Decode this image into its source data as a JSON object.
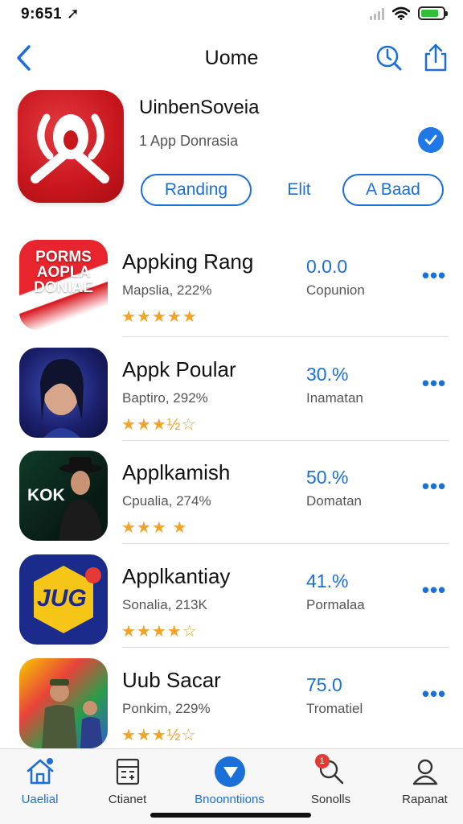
{
  "status_bar": {
    "time": "9:651 ➚",
    "battery_level": 0.8,
    "battery_color": "#2fbf3a"
  },
  "nav": {
    "title": "Uome",
    "icons": [
      "back-chevron-icon",
      "clock-search-icon",
      "share-icon"
    ]
  },
  "featured": {
    "title": "UinbenSoveia",
    "subtitle": "1 App Donrasia",
    "verified_icon": "checkmark-badge-icon",
    "buttons": [
      {
        "label": "Randing",
        "style": "outline"
      },
      {
        "label": "Elit",
        "style": "plain"
      },
      {
        "label": "A Baad",
        "style": "outline"
      }
    ]
  },
  "apps": [
    {
      "name": "Appking Rang",
      "meta": "Mapslia, 222%",
      "rating": 4.5,
      "value": "0.0.0",
      "label": "Copunion",
      "icon_text": "PORMS AOPLA DONIAE"
    },
    {
      "name": "Appk Poular",
      "meta": "Baptiro, 292%",
      "rating": 3.5,
      "value": "30.%",
      "label": "Inamatan",
      "icon_text": ""
    },
    {
      "name": "Applkamish",
      "meta": "Cpualia, 274%",
      "rating": 3.5,
      "value": "50.%",
      "label": "Domatan",
      "icon_text": "KOK"
    },
    {
      "name": "Applkantiay",
      "meta": "Sonalia, 213K",
      "rating": 4,
      "value": "41.%",
      "label": "Pormalaa",
      "icon_text": "JUG"
    },
    {
      "name": "Uub Sacar",
      "meta": "Ponkim, 229%",
      "rating": 3.5,
      "value": "75.0",
      "label": "Tromatiel",
      "icon_text": ""
    }
  ],
  "stars": {
    "row1": "★★★★★",
    "row2": "★★★½☆",
    "row3": "★★★ ★",
    "row4": "★★★★☆",
    "row5": "★★★½☆"
  },
  "tabs": [
    {
      "label": "Uaelial",
      "icon": "home-icon",
      "active": true
    },
    {
      "label": "Ctianet",
      "icon": "calculator-icon",
      "active": false
    },
    {
      "label": "Bnoonntiions",
      "icon": "play-circle-icon",
      "active": true
    },
    {
      "label": "Sonolls",
      "icon": "search-icon",
      "active": false,
      "badge": "1"
    },
    {
      "label": "Rapanat",
      "icon": "person-icon",
      "active": false
    }
  ],
  "colors": {
    "accent": "#1a6fd8",
    "star": "#f3a425",
    "brand_red": "#c8161d"
  }
}
